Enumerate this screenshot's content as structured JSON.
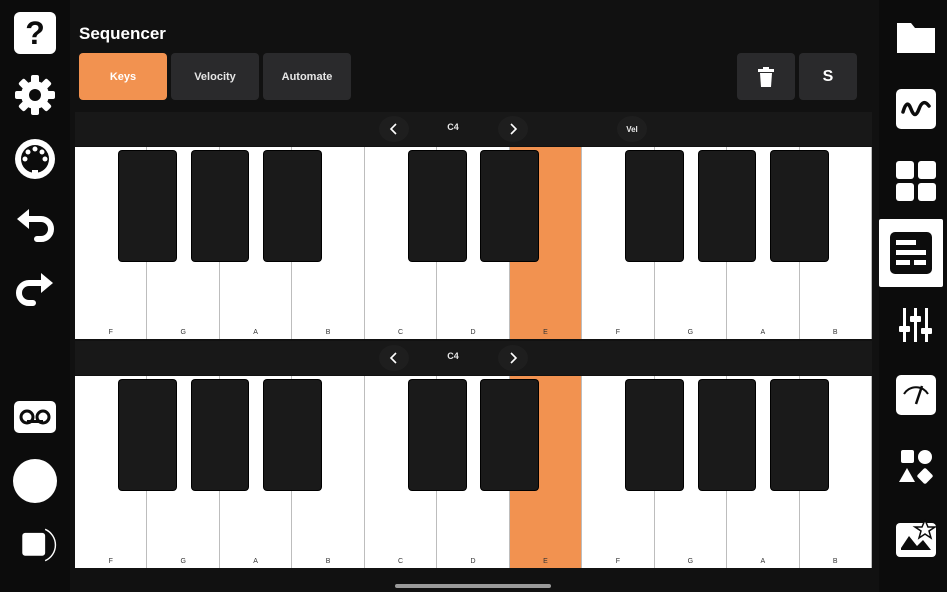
{
  "header": {
    "title": "Sequencer"
  },
  "tabs": [
    {
      "label": "Keys",
      "active": true
    },
    {
      "label": "Velocity",
      "active": false
    },
    {
      "label": "Automate",
      "active": false
    }
  ],
  "actions": {
    "delete_icon": "trash-icon",
    "s_label": "S"
  },
  "upper_bar": {
    "octave": "C4",
    "vel_label": "Vel"
  },
  "lower_bar": {
    "octave": "C4"
  },
  "white_keys": [
    "F",
    "G",
    "A",
    "B",
    "C",
    "D",
    "E",
    "F",
    "G",
    "A",
    "B"
  ],
  "active_key_index": 6,
  "colors": {
    "accent": "#f29250",
    "panel": "#2a2a2c",
    "background": "#111111"
  },
  "left_rail_icons": [
    "help-icon",
    "settings-gear-icon",
    "midi-port-icon",
    "undo-icon",
    "redo-icon",
    "tape-recorder-icon",
    "record-button-icon",
    "stop-button-icon"
  ],
  "right_rail_icons": [
    "folder-icon",
    "waveform-icon",
    "grid-pads-icon",
    "keyboard-sequencer-icon",
    "mixer-sliders-icon",
    "meter-gauge-icon",
    "shapes-icon",
    "star-image-icon"
  ]
}
